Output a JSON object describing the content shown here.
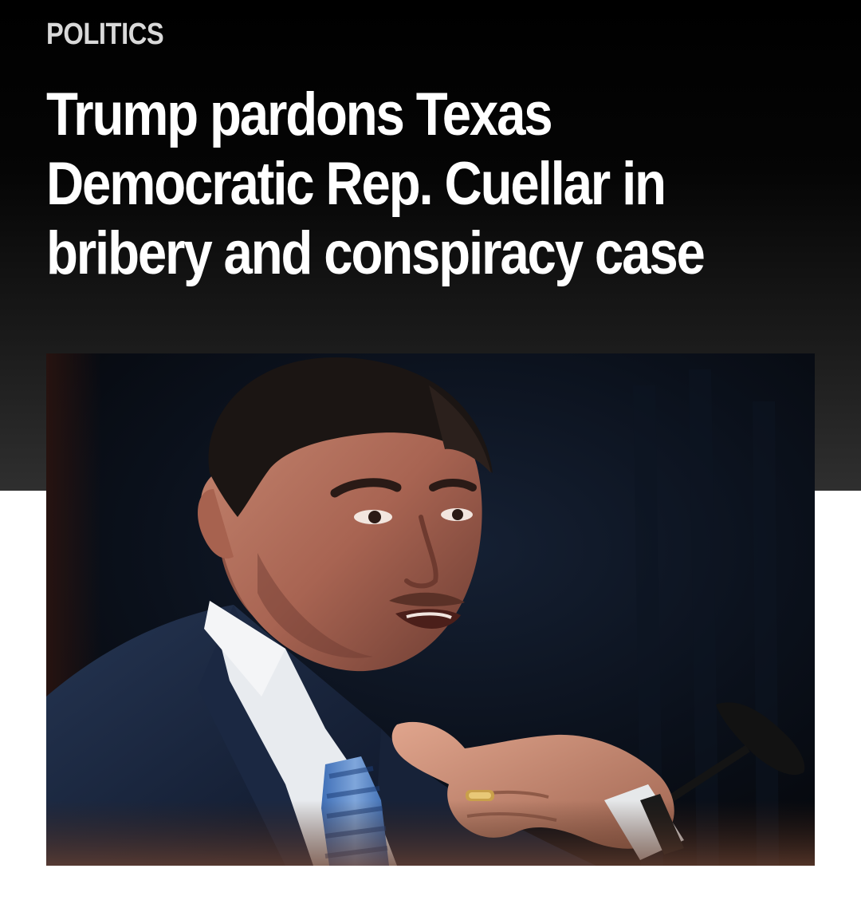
{
  "article": {
    "section": "POLITICS",
    "headline": "Trump pardons Texas Democratic Rep. Cuellar in bribery and conspiracy case"
  },
  "hero_image": {
    "subject": "man-speaking-at-hearing-photo",
    "background_color": "#0a0f18"
  },
  "colors": {
    "header_background": "#000000",
    "headline_text": "#ffffff",
    "section_text": "#d9d9d9",
    "page_background": "#ffffff"
  }
}
